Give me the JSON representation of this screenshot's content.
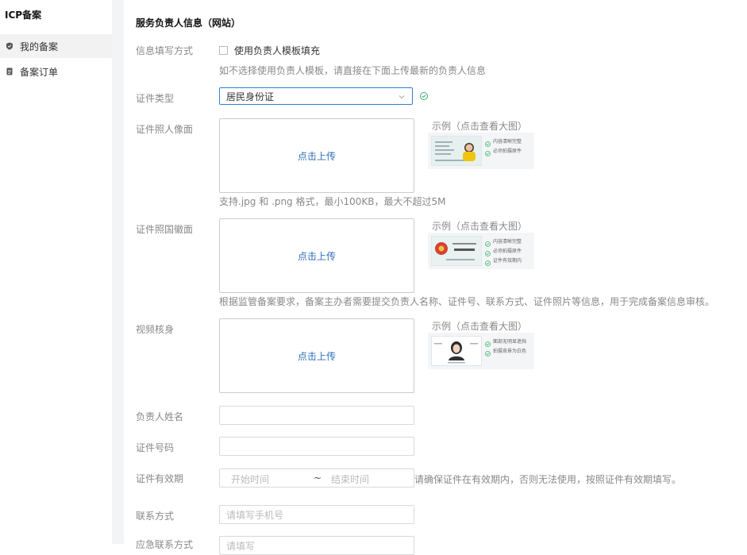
{
  "sidebar": {
    "title": "ICP备案",
    "items": [
      {
        "label": "我的备案",
        "icon": "shield-icon",
        "active": true
      },
      {
        "label": "备案订单",
        "icon": "document-icon",
        "active": false
      }
    ]
  },
  "form": {
    "section_title": "服务负责人信息（网站）",
    "fill_method": {
      "label": "信息填写方式",
      "checkbox_label": "使用负责人模板填充",
      "hint": "如不选择使用负责人模板，请直接在下面上传最新的负责人信息"
    },
    "id_type": {
      "label": "证件类型",
      "value": "居民身份证"
    },
    "id_front": {
      "label": "证件照人像面",
      "upload_text": "点击上传",
      "sample_title": "示例（点击查看大图）",
      "checks": [
        "内容清晰完整",
        "必须拍摄原件"
      ],
      "hint": "支持.jpg 和 .png 格式，最小100KB，最大不超过5M"
    },
    "id_back": {
      "label": "证件照国徽面",
      "upload_text": "点击上传",
      "sample_title": "示例（点击查看大图）",
      "checks": [
        "内容清晰完整",
        "必须拍摄原件",
        "证件有效期内"
      ],
      "hint": "根据监管备案要求，备案主办者需要提交负责人名称、证件号、联系方式、证件照片等信息，用于完成备案信息审核。"
    },
    "video_verify": {
      "label": "视频核身",
      "upload_text": "点击上传",
      "sample_title": "示例（点击查看大图）",
      "checks": [
        "面部无明显遮挡",
        "拍摄背景为白色"
      ]
    },
    "name": {
      "label": "负责人姓名",
      "placeholder": ""
    },
    "id_number": {
      "label": "证件号码",
      "placeholder": ""
    },
    "validity": {
      "label": "证件有效期",
      "start_placeholder": "开始时间",
      "separator": "~",
      "end_placeholder": "结束时间",
      "hint": "请确保证件在有效期内，否则无法使用，按照证件有效期填写。"
    },
    "contact": {
      "label": "联系方式",
      "placeholder": "请填写手机号"
    },
    "emergency": {
      "label": "应急联系方式",
      "placeholder": "请填写"
    }
  },
  "colors": {
    "accent": "#2f7fd5",
    "link": "#2f6fb8",
    "success": "#3bb36b"
  }
}
